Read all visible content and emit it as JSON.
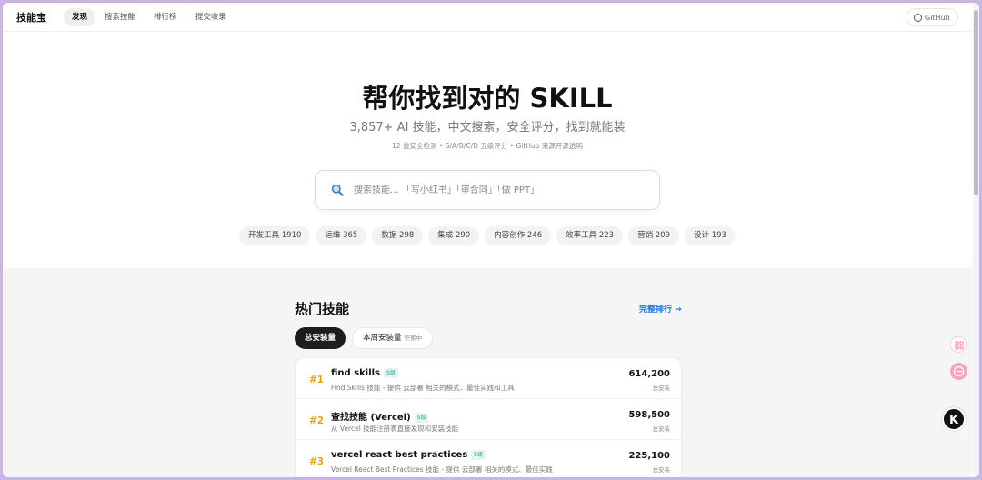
{
  "nav": {
    "logo": "技能宝",
    "tabs": [
      {
        "label": "发现",
        "active": true
      },
      {
        "label": "搜索技能",
        "active": false
      },
      {
        "label": "排行榜",
        "active": false
      },
      {
        "label": "提交收录",
        "active": false
      }
    ],
    "github_label": "GitHub"
  },
  "hero": {
    "title": "帮你找到对的 SKILL",
    "subtitle": "3,857+ AI 技能，中文搜索，安全评分，找到就能装",
    "meta": "12 重安全检测 • S/A/B/C/D 五级评分 • GitHub 来源开源透明"
  },
  "search": {
    "placeholder": "搜索技能... 「写小红书」「审合同」「做 PPT」",
    "value": ""
  },
  "categories": [
    {
      "label": "开发工具 1910"
    },
    {
      "label": "运维 365"
    },
    {
      "label": "数据 298"
    },
    {
      "label": "集成 290"
    },
    {
      "label": "内容创作 246"
    },
    {
      "label": "效率工具 223"
    },
    {
      "label": "营销 209"
    },
    {
      "label": "设计 193"
    }
  ],
  "hot": {
    "title": "热门技能",
    "more_label": "完整排行 →",
    "tabs": [
      {
        "label": "总安装量",
        "note": ""
      },
      {
        "label": "本周安装量",
        "note": "积累中"
      }
    ],
    "items": [
      {
        "rank": "#1",
        "name": "find skills",
        "grade": "S级",
        "desc": "Find Skills 技能 - 提供 云部署 相关的模式、最佳实践和工具",
        "count": "614,200",
        "count_label": "总安装"
      },
      {
        "rank": "#2",
        "name": "查找技能 (Vercel)",
        "grade": "S级",
        "desc": "从 Vercel 技能注册表直接发现和安装技能",
        "count": "598,500",
        "count_label": "总安装"
      },
      {
        "rank": "#3",
        "name": "vercel react best practices",
        "grade": "S级",
        "desc": "Vercel React Best Practices 技能 - 提供 云部署 相关的模式、最佳实践",
        "count": "225,100",
        "count_label": "总安装"
      }
    ]
  },
  "floating": {
    "badge_letter": "K"
  },
  "colors": {
    "accent": "#1a73e8",
    "rank": "#e8a317",
    "grade_text": "#2a9d8f",
    "dark_pill": "#1d1d1d"
  }
}
